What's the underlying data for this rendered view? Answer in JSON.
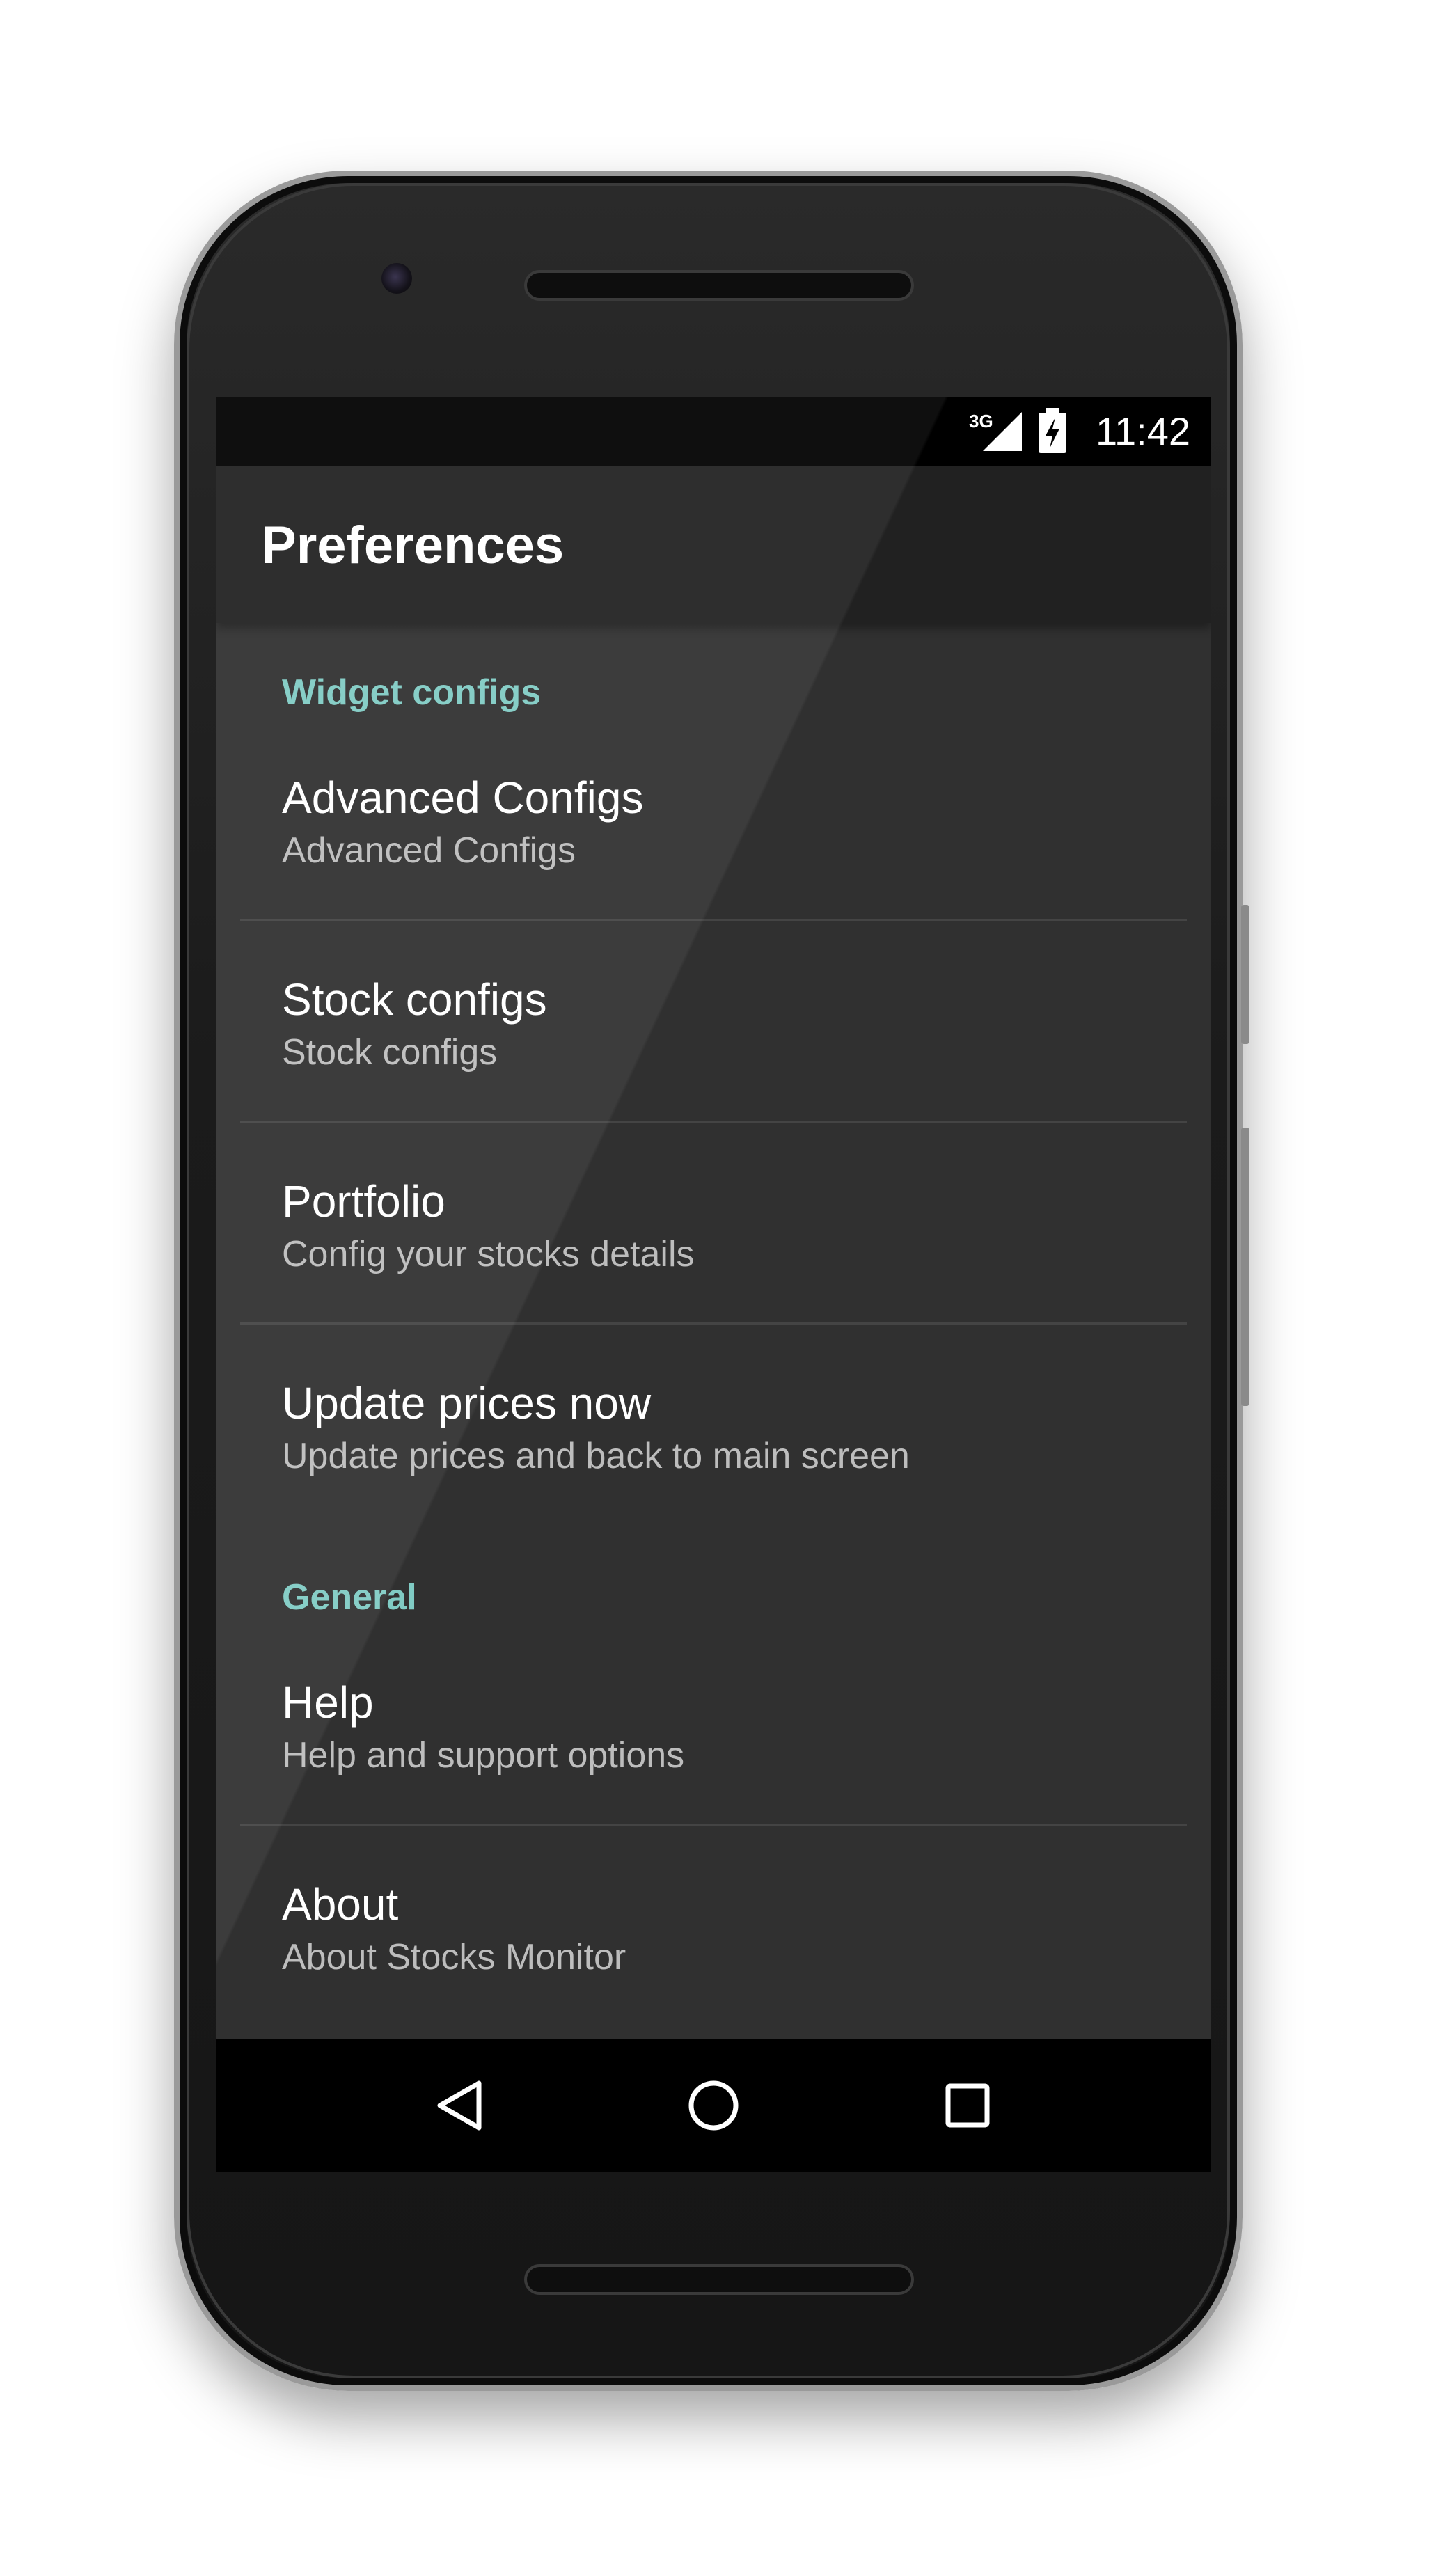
{
  "status_bar": {
    "network": "3G",
    "time": "11:42"
  },
  "toolbar": {
    "title": "Preferences"
  },
  "categories": {
    "widget": "Widget configs",
    "general": "General"
  },
  "preferences": [
    {
      "title": "Advanced Configs",
      "summary": "Advanced Configs"
    },
    {
      "title": "Stock configs",
      "summary": "Stock configs"
    },
    {
      "title": "Portfolio",
      "summary": "Config your stocks details"
    },
    {
      "title": "Update prices now",
      "summary": "Update prices and back to main screen"
    },
    {
      "title": "Help",
      "summary": "Help and support options"
    },
    {
      "title": "About",
      "summary": "About Stocks Monitor"
    }
  ],
  "colors": {
    "accent": "#80cbc4",
    "background": "#303030",
    "toolbar": "#212121"
  },
  "icons": {
    "signal": "cell-signal-icon",
    "battery": "battery-charging-icon",
    "back": "back-icon",
    "home": "home-icon",
    "recents": "recents-icon"
  }
}
